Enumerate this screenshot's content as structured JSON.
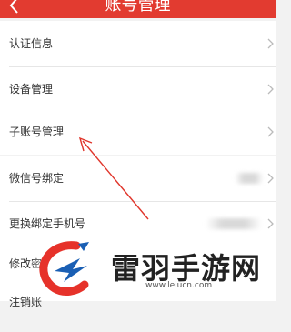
{
  "header": {
    "title": "账号管理",
    "back_icon": "chevron-left-icon",
    "background": "#e23b30"
  },
  "groups": [
    {
      "rows": [
        {
          "label": "认证信息"
        },
        {
          "label": "设备管理"
        }
      ]
    },
    {
      "rows": [
        {
          "label": "子账号管理"
        }
      ]
    },
    {
      "rows": [
        {
          "label": "微信号绑定",
          "value": ""
        },
        {
          "label": "更换绑定手机号",
          "value": ""
        }
      ]
    },
    {
      "rows": [
        {
          "label": "修改密"
        },
        {
          "label": "注销账"
        }
      ]
    }
  ],
  "annotation": {
    "color": "#e0352b",
    "points_to": "子账号管理"
  },
  "watermark": {
    "text": "雷羽手游网",
    "url": "www.leiucn.com"
  }
}
